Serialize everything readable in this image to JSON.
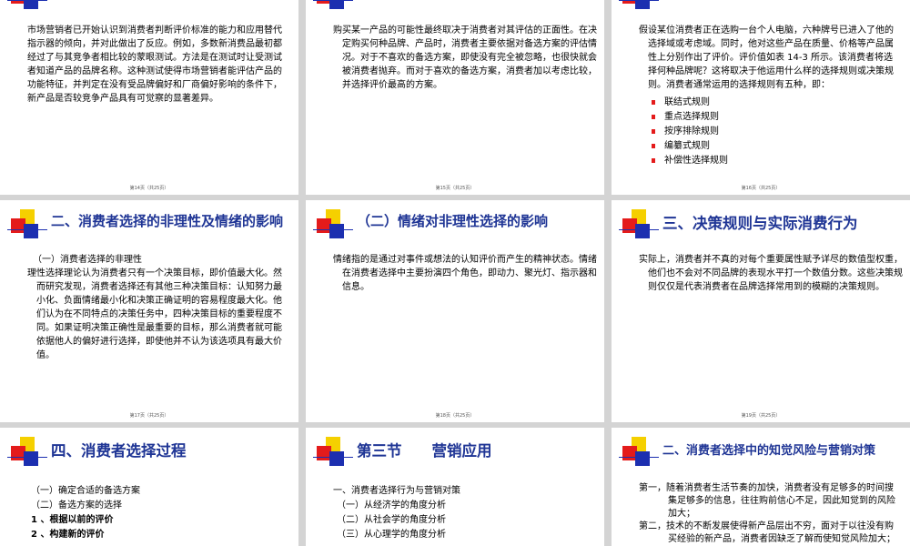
{
  "slides": {
    "s14": {
      "body": "市场营销者已开始认识到消费者判断评价标准的能力和应用替代指示器的倾向，并对此做出了反应。例如，多数新消费品最初都经过了与其竞争者相比较的蒙眼测试。方法是在测试时让受测试者知道产品的品牌名称。这种测试使得市场营销者能评估产品的功能特征，并判定在没有受品牌偏好和厂商偏好影响的条件下，新产品是否较竞争产品具有可觉察的显著差异。",
      "footer": "第14页（共25页）"
    },
    "s15": {
      "body": "购买某一产品的可能性最终取决于消费者对其评估的正面性。在决定购买何种品牌、产品时，消费者主要依据对备选方案的评估情况。对于不喜欢的备选方案，即使没有完全被忽略，也很快就会被消费者抛弃。而对于喜欢的备选方案，消费者加以考虑比较，并选择评价最高的方案。",
      "footer": "第15页（共25页）"
    },
    "s16": {
      "body": "假设某位消费者正在选购一台个人电脑，六种牌号已进入了他的选择域或考虑域。同时，他对这些产品在质量、价格等产品属性上分别作出了评价。评价值如表 14-3 所示。该消费者将选择何种品牌呢？这将取决于他运用什么样的选择规则或决策规则。消费者通常运用的选择规则有五种，即：",
      "bullets": [
        "联结式规则",
        "重点选择规则",
        "按序排除规则",
        "编纂式规则",
        "补偿性选择规则"
      ],
      "footer": "第16页（共25页）"
    },
    "s17": {
      "title": "二、消费者选择的非理性及情绪的影响",
      "subhead": "（一）消费者选择的非理性",
      "body": "理性选择理论认为消费者只有一个决策目标，即价值最大化。然而研究发现，消费者选择还有其他三种决策目标：认知努力最小化、负面情绪最小化和决策正确证明的容易程度最大化。他们认为在不同特点的决策任务中，四种决策目标的重要程度不同。如果证明决策正确性是最重要的目标，那么消费者就可能依据他人的偏好进行选择，即使他并不认为该选项具有最大价值。",
      "footer": "第17页（共25页）"
    },
    "s18": {
      "title": "（二）情绪对非理性选择的影响",
      "body": "情绪指的是通过对事件或想法的认知评价而产生的精神状态。情绪在消费者选择中主要扮演四个角色，即动力、聚光灯、指示器和信息。",
      "footer": "第18页（共25页）"
    },
    "s19": {
      "title": "三、决策规则与实际消费行为",
      "body": "实际上，消费者并不真的对每个重要属性赋予详尽的数值型权重，他们也不会对不同品牌的表现水平打一个数值分数。这些决策规则仅仅是代表消费者在品牌选择常用到的模糊的决策规则。",
      "footer": "第19页（共25页）"
    },
    "s20": {
      "title": "四、消费者选择过程",
      "lines": [
        "（一）确定合适的备选方案",
        "（二）备选方案的选择",
        "1 、根据以前的评价",
        "2 、构建新的评价"
      ]
    },
    "s21": {
      "title": "第三节　　营销应用",
      "lines": [
        "一、消费者选择行为与营销对策",
        "（一）从经济学的角度分析",
        "（二）从社会学的角度分析",
        "（三）从心理学的角度分析"
      ]
    },
    "s22": {
      "title": "二、消费者选择中的知觉风险与营销对策",
      "paras": [
        "第一，随着消费者生活节奏的加快，消费者没有足够多的时间搜集足够多的信息，往往购前信心不足，因此知觉到的风险加大；",
        "第二，技术的不断发展使得新产品层出不穷，面对于以往没有购买经验的新产品，消费者因缺乏了解而使知觉风险加大；"
      ]
    }
  },
  "colors": {
    "title": "#1f3595",
    "bullet": "#e41b1b",
    "logo_yellow": "#f5d000",
    "logo_red": "#e41b1b",
    "logo_blue": "#1c2fb0"
  }
}
